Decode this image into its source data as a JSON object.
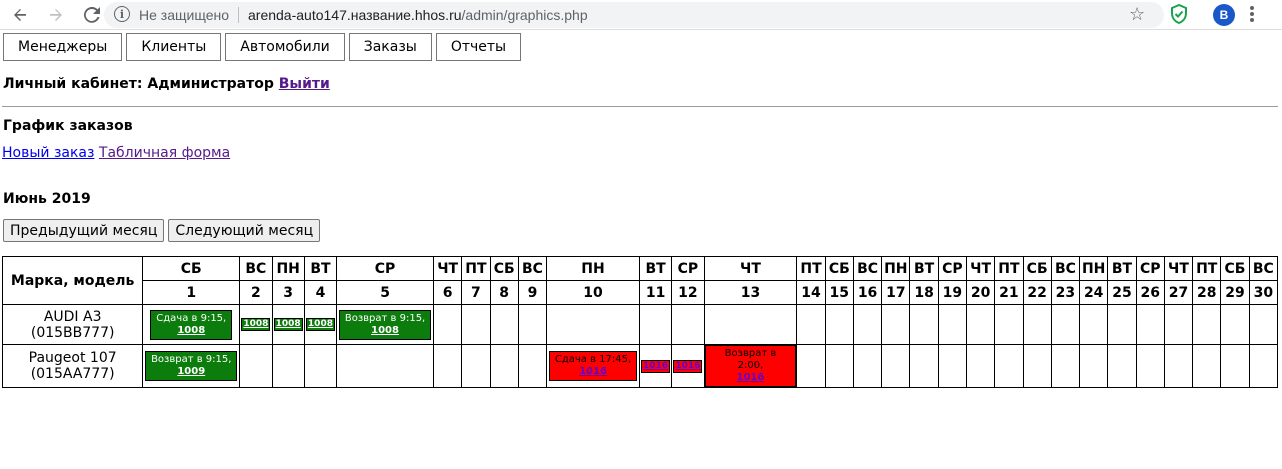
{
  "browser": {
    "insecure_label": "Не защищено",
    "url_host": "arenda-auto147.название.hhos.ru",
    "url_path": "/admin/graphics.php",
    "avatar_letter": "B"
  },
  "nav": [
    "Менеджеры",
    "Клиенты",
    "Автомобили",
    "Заказы",
    "Отчеты"
  ],
  "cabinet": {
    "label": "Личный кабинет: Администратор",
    "logout": "Выйти"
  },
  "schedule_title": "График заказов",
  "links": {
    "new_order": "Новый заказ",
    "table_form": "Табличная форма"
  },
  "month": "Июнь 2019",
  "month_buttons": {
    "prev": "Предыдущий месяц",
    "next": "Следующий месяц"
  },
  "table": {
    "model_header": "Марка, модель",
    "days": [
      {
        "dow": "СБ",
        "num": "1"
      },
      {
        "dow": "ВС",
        "num": "2"
      },
      {
        "dow": "ПН",
        "num": "3"
      },
      {
        "dow": "ВТ",
        "num": "4"
      },
      {
        "dow": "СР",
        "num": "5"
      },
      {
        "dow": "ЧТ",
        "num": "6"
      },
      {
        "dow": "ПТ",
        "num": "7"
      },
      {
        "dow": "СБ",
        "num": "8"
      },
      {
        "dow": "ВС",
        "num": "9"
      },
      {
        "dow": "ПН",
        "num": "10"
      },
      {
        "dow": "ВТ",
        "num": "11"
      },
      {
        "dow": "СР",
        "num": "12"
      },
      {
        "dow": "ЧТ",
        "num": "13"
      },
      {
        "dow": "ПТ",
        "num": "14"
      },
      {
        "dow": "СБ",
        "num": "15"
      },
      {
        "dow": "ВС",
        "num": "16"
      },
      {
        "dow": "ПН",
        "num": "17"
      },
      {
        "dow": "ВТ",
        "num": "18"
      },
      {
        "dow": "СР",
        "num": "19"
      },
      {
        "dow": "ЧТ",
        "num": "20"
      },
      {
        "dow": "ПТ",
        "num": "21"
      },
      {
        "dow": "СБ",
        "num": "22"
      },
      {
        "dow": "ВС",
        "num": "23"
      },
      {
        "dow": "ПН",
        "num": "24"
      },
      {
        "dow": "ВТ",
        "num": "25"
      },
      {
        "dow": "СР",
        "num": "26"
      },
      {
        "dow": "ЧТ",
        "num": "27"
      },
      {
        "dow": "ПТ",
        "num": "28"
      },
      {
        "dow": "СБ",
        "num": "29"
      },
      {
        "dow": "ВС",
        "num": "30"
      }
    ],
    "rows": [
      {
        "car": "AUDI A3",
        "plate": "(015BB777)",
        "events": [
          {
            "day": 1,
            "text": "Сдача в 9:15,",
            "order": "1008",
            "color": "green"
          },
          {
            "day": 2,
            "text": "",
            "order": "1008",
            "color": "green"
          },
          {
            "day": 3,
            "text": "",
            "order": "1008",
            "color": "green"
          },
          {
            "day": 4,
            "text": "",
            "order": "1008",
            "color": "green"
          },
          {
            "day": 5,
            "text": "Возврат в 9:15,",
            "order": "1008",
            "color": "green"
          }
        ]
      },
      {
        "car": "Paugeot 107",
        "plate": "(015AA777)",
        "events": [
          {
            "day": 1,
            "text": "Возврат в 9:15,",
            "order": "1009",
            "color": "green"
          },
          {
            "day": 10,
            "text": "Сдача в 17:45,",
            "order": "1016",
            "color": "red"
          },
          {
            "day": 11,
            "text": "",
            "order": "1016",
            "color": "red"
          },
          {
            "day": 12,
            "text": "",
            "order": "1016",
            "color": "red"
          },
          {
            "day": 13,
            "text": "Возврат в 2:00,",
            "order": "1016",
            "color": "red"
          }
        ]
      }
    ]
  }
}
